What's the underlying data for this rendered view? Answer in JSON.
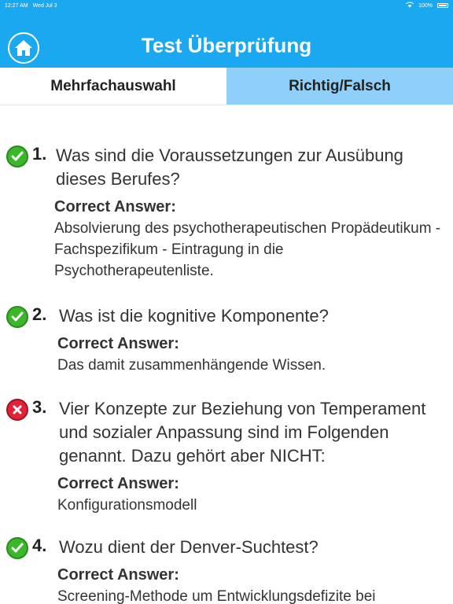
{
  "status_bar": {
    "time": "12:27 AM",
    "date": "Wed Jul 3",
    "battery": "100%",
    "icons": [
      "wifi-icon",
      "battery-icon"
    ]
  },
  "header": {
    "title": "Test Überprüfung",
    "home_icon": "home-icon"
  },
  "tabs": [
    {
      "label": "Mehrfachauswahl",
      "active": true
    },
    {
      "label": "Richtig/Falsch",
      "active": false
    }
  ],
  "colors": {
    "accent": "#1aa8f0",
    "tab_inactive": "#8fd0fa",
    "correct": "#3bb72a",
    "wrong": "#e0223a"
  },
  "answer_label": "Correct Answer:",
  "questions": [
    {
      "number": "1.",
      "status": "correct",
      "text": "Was sind die Voraussetzungen zur Ausübung dieses Berufes?",
      "answer": "Absolvierung des psychotherapeutischen Propädeutikum - Fachspezifikum - Eintragung in die Psychotherapeutenliste."
    },
    {
      "number": "2.",
      "status": "correct",
      "text": "Was ist die kognitive Komponente?",
      "answer": "Das damit zusammenhängende Wissen."
    },
    {
      "number": "3.",
      "status": "wrong",
      "text": "Vier Konzepte zur Beziehung von Temperament und sozialer Anpassung sind im Folgenden genannt. Dazu gehört aber NICHT:",
      "answer": "Konfigurationsmodell"
    },
    {
      "number": "4.",
      "status": "correct",
      "text": "Wozu dient der Denver-Suchtest?",
      "answer": "Screening-Methode um Entwicklungsdefizite bei"
    }
  ]
}
